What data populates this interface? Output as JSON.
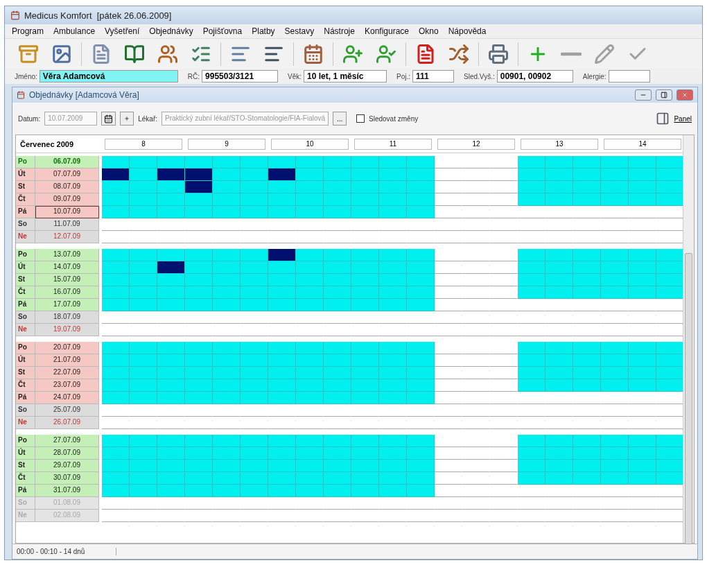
{
  "window": {
    "title": "Medicus Komfort  [pátek 26.06.2009]"
  },
  "menu": [
    "Program",
    "Ambulance",
    "Vyšetření",
    "Objednávky",
    "Pojišťovna",
    "Platby",
    "Sestavy",
    "Nástroje",
    "Konfigurace",
    "Okno",
    "Nápověda"
  ],
  "patient": [
    {
      "label": "Jméno:",
      "value": "Věra Adamcová",
      "highlighted": true
    },
    {
      "label": "RČ:",
      "value": "995503/3121",
      "highlighted": false
    },
    {
      "label": "Věk:",
      "value": "10 let, 1 měsíc",
      "highlighted": false
    },
    {
      "label": "Poj.:",
      "value": "111",
      "highlighted": false
    },
    {
      "label": "Sled.Vyš.:",
      "value": "00901, 00902",
      "highlighted": false
    },
    {
      "label": "Alergie:",
      "highlighted": false
    }
  ],
  "child": {
    "title": "Objednávky [Adamcová Věra]",
    "date_label": "Datum:",
    "date": "10.07.2009",
    "doctor_label": "Lékař:",
    "doctor": "Praktický zubní lékař/STO-Stomatologie/FIA-Fialová",
    "browse": "...",
    "track": {
      "label": "Sledovat změny",
      "checked": false
    },
    "panel": "Panel"
  },
  "calendar": {
    "month": "Červenec 2009",
    "hours": [
      "8",
      "9",
      "10",
      "11",
      "12",
      "13",
      "14"
    ],
    "weeks": [
      {
        "days": [
          {
            "dow": "Po",
            "date": "06.07.09",
            "kind": "weekday",
            "color": "#c4f0b8",
            "selected": false,
            "highlighted": true
          },
          {
            "dow": "Út",
            "date": "07.07.09",
            "kind": "weekday",
            "color": "#f6c8c4",
            "selected": false,
            "highlighted": false,
            "booked": [
              true,
              false,
              true,
              true,
              false,
              false,
              true,
              false,
              false,
              false,
              false,
              false,
              false,
              false,
              false,
              false,
              false,
              false,
              false,
              false,
              false
            ]
          },
          {
            "dow": "St",
            "date": "08.07.09",
            "kind": "weekday",
            "color": "#f6c8c4",
            "selected": false,
            "highlighted": false,
            "booked": [
              false,
              false,
              false,
              true,
              false,
              false,
              false,
              false,
              false,
              false,
              false,
              false,
              false,
              false,
              false,
              false,
              false,
              false,
              false,
              false,
              false
            ]
          },
          {
            "dow": "Čt",
            "date": "09.07.09",
            "kind": "weekday",
            "color": "#f6c8c4",
            "selected": false,
            "highlighted": false
          },
          {
            "dow": "Pá",
            "date": "10.07.09",
            "kind": "friday",
            "color": "#f6c8c4",
            "selected": true,
            "highlighted": false
          },
          {
            "dow": "So",
            "date": "11.07.09",
            "kind": "saturday",
            "color": "#dcdcdc",
            "selected": false,
            "highlighted": false
          },
          {
            "dow": "Ne",
            "date": "12.07.09",
            "kind": "sunday",
            "color": "#dcdcdc",
            "selected": false,
            "highlighted": false
          }
        ]
      },
      {
        "days": [
          {
            "dow": "Po",
            "date": "13.07.09",
            "kind": "weekday",
            "color": "#c4f0b8",
            "selected": false,
            "highlighted": false,
            "booked": [
              false,
              false,
              false,
              false,
              false,
              false,
              true,
              false,
              false,
              false,
              false,
              false,
              false,
              false,
              false,
              false,
              false,
              false,
              false,
              false,
              false
            ]
          },
          {
            "dow": "Út",
            "date": "14.07.09",
            "kind": "weekday",
            "color": "#c4f0b8",
            "selected": false,
            "highlighted": false,
            "booked": [
              false,
              false,
              true,
              false,
              false,
              false,
              false,
              false,
              false,
              false,
              false,
              false,
              false,
              false,
              false,
              false,
              false,
              false,
              false,
              false,
              false
            ]
          },
          {
            "dow": "St",
            "date": "15.07.09",
            "kind": "weekday",
            "color": "#c4f0b8",
            "selected": false,
            "highlighted": false
          },
          {
            "dow": "Čt",
            "date": "16.07.09",
            "kind": "weekday",
            "color": "#c4f0b8",
            "selected": false,
            "highlighted": false
          },
          {
            "dow": "Pá",
            "date": "17.07.09",
            "kind": "friday",
            "color": "#c4f0b8",
            "selected": false,
            "highlighted": false
          },
          {
            "dow": "So",
            "date": "18.07.09",
            "kind": "saturday",
            "color": "#dcdcdc",
            "selected": false,
            "highlighted": false
          },
          {
            "dow": "Ne",
            "date": "19.07.09",
            "kind": "sunday",
            "color": "#dcdcdc",
            "selected": false,
            "highlighted": false
          }
        ]
      },
      {
        "days": [
          {
            "dow": "Po",
            "date": "20.07.09",
            "kind": "weekday",
            "color": "#f6c8c4",
            "selected": false,
            "highlighted": false
          },
          {
            "dow": "Út",
            "date": "21.07.09",
            "kind": "weekday",
            "color": "#f6c8c4",
            "selected": false,
            "highlighted": false
          },
          {
            "dow": "St",
            "date": "22.07.09",
            "kind": "weekday",
            "color": "#f6c8c4",
            "selected": false,
            "highlighted": false
          },
          {
            "dow": "Čt",
            "date": "23.07.09",
            "kind": "weekday",
            "color": "#f6c8c4",
            "selected": false,
            "highlighted": false
          },
          {
            "dow": "Pá",
            "date": "24.07.09",
            "kind": "friday",
            "color": "#f6c8c4",
            "selected": false,
            "highlighted": false
          },
          {
            "dow": "So",
            "date": "25.07.09",
            "kind": "saturday",
            "color": "#dcdcdc",
            "selected": false,
            "highlighted": false
          },
          {
            "dow": "Ne",
            "date": "26.07.09",
            "kind": "sunday",
            "color": "#dcdcdc",
            "selected": false,
            "highlighted": false
          }
        ]
      },
      {
        "days": [
          {
            "dow": "Po",
            "date": "27.07.09",
            "kind": "weekday",
            "color": "#c4f0b8",
            "selected": false,
            "highlighted": false
          },
          {
            "dow": "Út",
            "date": "28.07.09",
            "kind": "weekday",
            "color": "#c4f0b8",
            "selected": false,
            "highlighted": false
          },
          {
            "dow": "St",
            "date": "29.07.09",
            "kind": "weekday",
            "color": "#c4f0b8",
            "selected": false,
            "highlighted": false
          },
          {
            "dow": "Čt",
            "date": "30.07.09",
            "kind": "weekday",
            "color": "#c4f0b8",
            "selected": false,
            "highlighted": false
          },
          {
            "dow": "Pá",
            "date": "31.07.09",
            "kind": "friday",
            "color": "#c4f0b8",
            "selected": false,
            "highlighted": false
          },
          {
            "dow": "So",
            "date": "01.08.09",
            "kind": "outside",
            "color": "#e4e4e4",
            "selected": false,
            "highlighted": false
          },
          {
            "dow": "Ne",
            "date": "02.08.09",
            "kind": "outside",
            "color": "#e4e4e4",
            "selected": false,
            "highlighted": false
          }
        ]
      }
    ]
  },
  "status_bar": [
    "00:00 - 00:10 - 14 dnů"
  ]
}
